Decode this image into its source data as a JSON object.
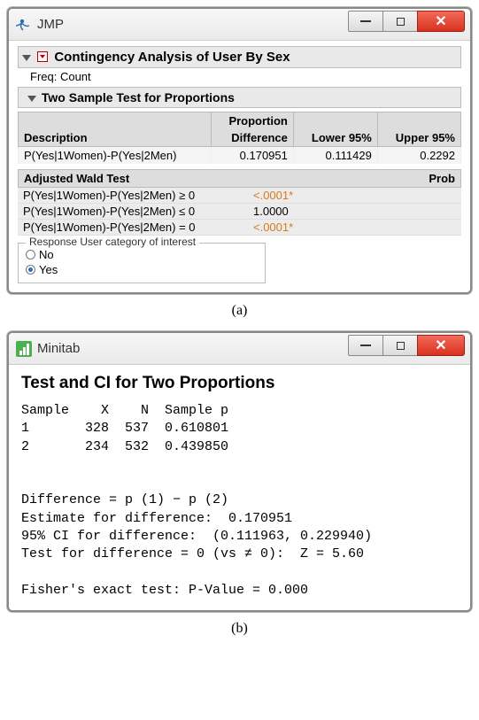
{
  "jmp": {
    "app_name": "JMP",
    "heading": "Contingency Analysis of User By Sex",
    "freq_label": "Freq: Count",
    "subheading": "Two Sample Test for Proportions",
    "table": {
      "headers": {
        "desc": "Description",
        "diff1": "Proportion",
        "diff2": "Difference",
        "low": "Lower 95%",
        "up": "Upper 95%"
      },
      "row": {
        "desc": "P(Yes|1Women)-P(Yes|2Men)",
        "diff": "0.170951",
        "low": "0.111429",
        "up": "0.2292"
      }
    },
    "wald": {
      "title": "Adjusted Wald Test",
      "prob_label": "Prob",
      "rows": [
        {
          "desc": "P(Yes|1Women)-P(Yes|2Men) ≥ 0",
          "prob": "<.0001*",
          "sig": true
        },
        {
          "desc": "P(Yes|1Women)-P(Yes|2Men) ≤ 0",
          "prob": "1.0000",
          "sig": false
        },
        {
          "desc": "P(Yes|1Women)-P(Yes|2Men) = 0",
          "prob": "<.0001*",
          "sig": true
        }
      ]
    },
    "response": {
      "legend": "Response User category of interest",
      "options": [
        "No",
        "Yes"
      ],
      "selected": "Yes"
    }
  },
  "caption_a": "(a)",
  "minitab": {
    "app_name": "Minitab",
    "title": "Test and CI for Two Proportions",
    "table_header": "Sample    X    N  Sample p",
    "rows": [
      "1       328  537  0.610801",
      "2       234  532  0.439850"
    ],
    "lines": [
      "Difference = p (1) − p (2)",
      "Estimate for difference:  0.170951",
      "95% CI for difference:  (0.111963, 0.229940)",
      "Test for difference = 0 (vs ≠ 0):  Z = 5.60",
      "",
      "Fisher's exact test: P-Value = 0.000"
    ]
  },
  "caption_b": "(b)"
}
